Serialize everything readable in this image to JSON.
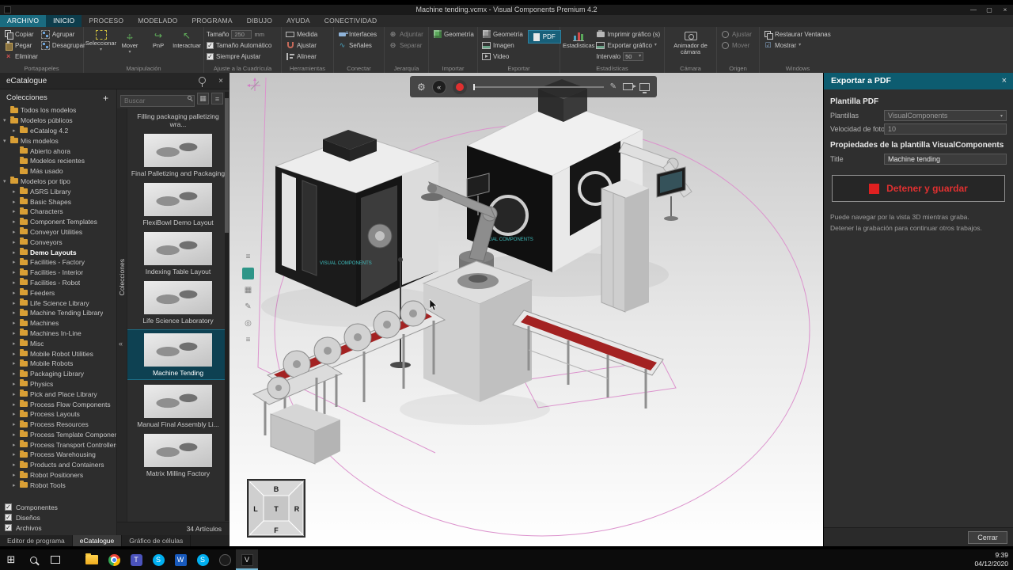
{
  "window": {
    "title": "Machine tending.vcmx - Visual Components Premium 4.2"
  },
  "icons": {
    "minimize": "—",
    "maximize": "▢",
    "close": "×",
    "plus": "+",
    "collapse": "«",
    "chevron_down": "▾",
    "chevron_right": "▸",
    "check": "✓",
    "arrow_h": "↔",
    "arrow_v": "↕",
    "pnp": "↪",
    "interact": "↖",
    "wave": "∿",
    "attach": "⊕",
    "detach": "⊖",
    "gear": "⚙",
    "menu": "≡",
    "pencil": "✎",
    "target": "◎",
    "skip_back": "«",
    "grid_view": "▦",
    "checklist": "☑",
    "start": "⊞"
  },
  "menu_tabs": [
    {
      "label": "ARCHIVO"
    },
    {
      "label": "INICIO"
    },
    {
      "label": "PROCESO"
    },
    {
      "label": "MODELADO"
    },
    {
      "label": "PROGRAMA"
    },
    {
      "label": "DIBUJO"
    },
    {
      "label": "AYUDA"
    },
    {
      "label": "CONECTIVIDAD"
    }
  ],
  "ribbon": {
    "clipboard": {
      "label": "Portapapeles",
      "copy": "Copiar",
      "paste": "Pegar",
      "delete": "Eliminar",
      "group": "Agrupar",
      "ungroup": "Desagrupar"
    },
    "manipulation": {
      "label": "Manipulación",
      "select": "Seleccionar",
      "move": "Mover",
      "pnp": "PnP",
      "interact": "Interactuar"
    },
    "grid": {
      "label": "Ajuste a la Cuadrícula",
      "size_label": "Tamaño",
      "size_value": "250",
      "size_unit": "mm",
      "auto_size": "Tamaño Automático",
      "always_snap": "Siempre Ajustar"
    },
    "tools": {
      "label": "Herramientas",
      "measure": "Medida",
      "snap": "Ajustar",
      "align": "Alinear"
    },
    "connect": {
      "label": "Conectar",
      "interfaces": "Interfaces",
      "signals": "Señales"
    },
    "hierarchy": {
      "label": "Jerarquía",
      "attach": "Adjuntar",
      "detach": "Separar"
    },
    "import": {
      "label": "Importar",
      "geometry": "Geometría"
    },
    "export": {
      "label": "Exportar",
      "geometry": "Geometría",
      "image": "Imagen",
      "video": "Video",
      "pdf": "PDF"
    },
    "stats": {
      "label": "Estadísticas",
      "button": "Estadísticas",
      "print_chart": "Imprimir gráfico (s)",
      "export_chart": "Exportar gráfico",
      "interval_label": "Intervalo",
      "interval_value": "50"
    },
    "camera": {
      "label": "Cámara",
      "animator": "Animador de cámara"
    },
    "origin": {
      "label": "Origen",
      "snap": "Ajustar",
      "move": "Mover"
    },
    "windows": {
      "label": "Windows",
      "restore": "Restaurar Ventanas",
      "show": "Mostrar"
    }
  },
  "catalogue": {
    "panel_title": "eCatalogue",
    "collections_title": "Colecciones",
    "side_tab": "Colecciones",
    "search_placeholder": "Buscar",
    "tree": [
      {
        "label": "Todos los modelos",
        "level": 0,
        "arrow": ""
      },
      {
        "label": "Modelos públicos",
        "level": 0,
        "arrow": "▾"
      },
      {
        "label": "eCatalog 4.2",
        "level": 1,
        "arrow": "▸"
      },
      {
        "label": "Mis modelos",
        "level": 0,
        "arrow": "▾"
      },
      {
        "label": "Abierto ahora",
        "level": 1,
        "arrow": ""
      },
      {
        "label": "Modelos recientes",
        "level": 1,
        "arrow": ""
      },
      {
        "label": "Más usado",
        "level": 1,
        "arrow": ""
      },
      {
        "label": "Modelos por tipo",
        "level": 0,
        "arrow": "▾"
      },
      {
        "label": "ASRS Library",
        "level": 1,
        "arrow": "▸"
      },
      {
        "label": "Basic Shapes",
        "level": 1,
        "arrow": "▸"
      },
      {
        "label": "Characters",
        "level": 1,
        "arrow": "▸"
      },
      {
        "label": "Component Templates",
        "level": 1,
        "arrow": "▸"
      },
      {
        "label": "Conveyor Utilities",
        "level": 1,
        "arrow": "▸"
      },
      {
        "label": "Conveyors",
        "level": 1,
        "arrow": "▸"
      },
      {
        "label": "Demo Layouts",
        "level": 1,
        "arrow": "▸",
        "bold": true
      },
      {
        "label": "Facilities - Factory",
        "level": 1,
        "arrow": "▸"
      },
      {
        "label": "Facilities - Interior",
        "level": 1,
        "arrow": "▸"
      },
      {
        "label": "Facilities - Robot",
        "level": 1,
        "arrow": "▸"
      },
      {
        "label": "Feeders",
        "level": 1,
        "arrow": "▸"
      },
      {
        "label": "Life Science Library",
        "level": 1,
        "arrow": "▸"
      },
      {
        "label": "Machine Tending Library",
        "level": 1,
        "arrow": "▸"
      },
      {
        "label": "Machines",
        "level": 1,
        "arrow": "▸"
      },
      {
        "label": "Machines In-Line",
        "level": 1,
        "arrow": "▸"
      },
      {
        "label": "Misc",
        "level": 1,
        "arrow": "▸"
      },
      {
        "label": "Mobile Robot Utilities",
        "level": 1,
        "arrow": "▸"
      },
      {
        "label": "Mobile Robots",
        "level": 1,
        "arrow": "▸"
      },
      {
        "label": "Packaging Library",
        "level": 1,
        "arrow": "▸"
      },
      {
        "label": "Physics",
        "level": 1,
        "arrow": "▸"
      },
      {
        "label": "Pick and Place Library",
        "level": 1,
        "arrow": "▸"
      },
      {
        "label": "Process Flow Components",
        "level": 1,
        "arrow": "▸"
      },
      {
        "label": "Process Layouts",
        "level": 1,
        "arrow": "▸"
      },
      {
        "label": "Process Resources",
        "level": 1,
        "arrow": "▸"
      },
      {
        "label": "Process Template Components",
        "level": 1,
        "arrow": "▸"
      },
      {
        "label": "Process Transport Controllers",
        "level": 1,
        "arrow": "▸"
      },
      {
        "label": "Process Warehousing",
        "level": 1,
        "arrow": "▸"
      },
      {
        "label": "Products and Containers",
        "level": 1,
        "arrow": "▸"
      },
      {
        "label": "Robot Positioners",
        "level": 1,
        "arrow": "▸"
      },
      {
        "label": "Robot Tools",
        "level": 1,
        "arrow": "▸"
      }
    ],
    "filters": [
      {
        "label": "Componentes",
        "checked": true
      },
      {
        "label": "Diseños",
        "checked": true
      },
      {
        "label": "Archivos",
        "checked": true
      }
    ],
    "results": [
      {
        "caption": "Filling packaging palletizing wra...",
        "text_only": true
      },
      {
        "caption": "Final Palletizing and Packaging"
      },
      {
        "caption": "FlexiBowl Demo Layout"
      },
      {
        "caption": "Indexing Table Layout"
      },
      {
        "caption": "Life Science Laboratory"
      },
      {
        "caption": "Machine Tending",
        "selected": true
      },
      {
        "caption": "Manual Final Assembly Li..."
      },
      {
        "caption": "Matrix Milling Factory"
      }
    ],
    "items_count": "34 Artículos"
  },
  "bottom_tabs": [
    {
      "label": "Editor de programa"
    },
    {
      "label": "eCatalogue",
      "active": true
    },
    {
      "label": "Gráfico de células"
    }
  ],
  "viewport": {
    "machine_logo": "VISUAL COMPONENTS",
    "view_cube": {
      "top": "B",
      "left": "L",
      "center": "T",
      "right": "R",
      "front": "F"
    }
  },
  "export_panel": {
    "title": "Exportar a PDF",
    "section_template": "Plantilla PDF",
    "templates_label": "Plantillas",
    "templates_value": "VisualComponents",
    "fps_label": "Velocidad de fotog",
    "fps_value": "10",
    "section_properties": "Propiedades de la plantilla VisualComponents",
    "title_label": "Title",
    "title_value": "Machine tending",
    "stop_button": "Detener y guardar",
    "hint1": "Puede navegar por la vista 3D mientras graba.",
    "hint2": "Detener la grabación para continuar otros trabajos.",
    "close_button": "Cerrar"
  },
  "taskbar": {
    "time": "9:39",
    "date": "04/12/2020",
    "icons": [
      {
        "name": "start-button",
        "type": "start",
        "glyph": "⊞"
      },
      {
        "name": "search-button",
        "type": "search"
      },
      {
        "name": "task-view-button",
        "type": "taskview"
      },
      {
        "name": "file-explorer-icon",
        "type": "explorer"
      },
      {
        "name": "chrome-icon",
        "type": "chrome"
      },
      {
        "name": "teams-icon",
        "type": "teams",
        "letter": "T"
      },
      {
        "name": "skype-icon",
        "type": "skype",
        "letter": "S"
      },
      {
        "name": "word-icon",
        "type": "word",
        "letter": "W"
      },
      {
        "name": "skype-business-icon",
        "type": "skype",
        "letter": "S"
      },
      {
        "name": "media-app-icon",
        "type": "dark"
      },
      {
        "name": "visual-components-icon",
        "type": "vc",
        "letter": "V",
        "active": true
      }
    ]
  }
}
